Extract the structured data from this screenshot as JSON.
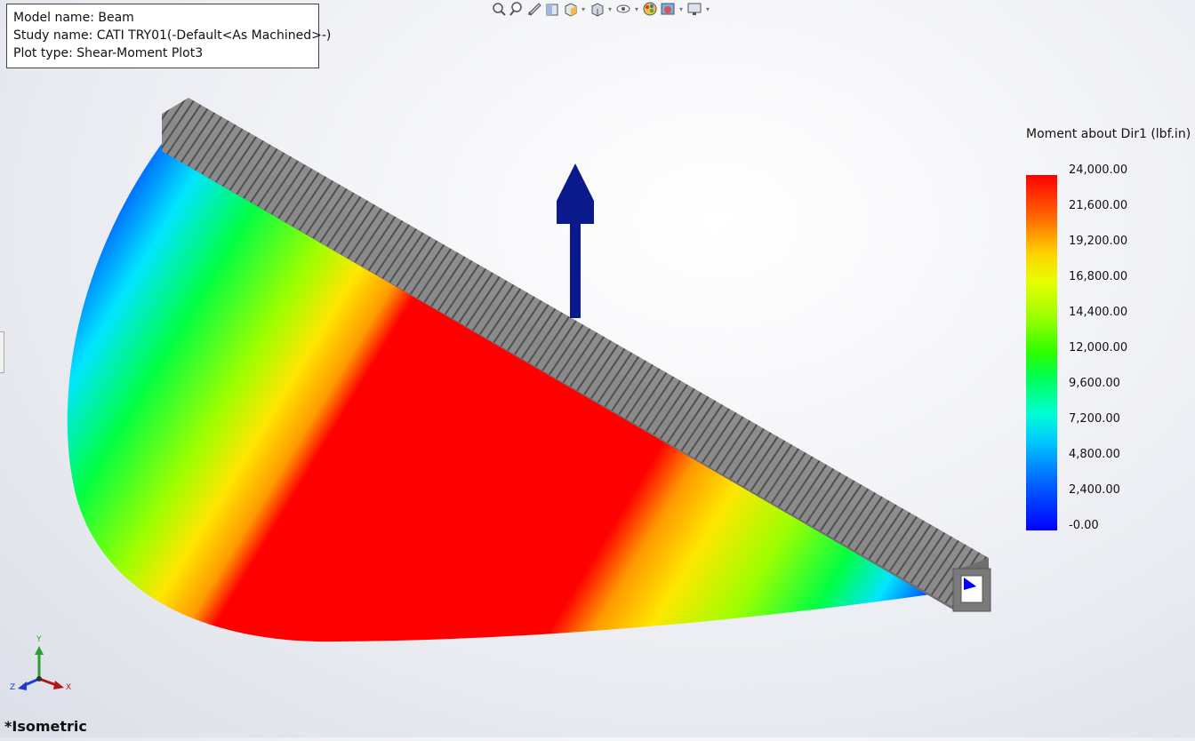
{
  "info": {
    "model_prefix": "Model name:",
    "model_name": "Beam",
    "study_prefix": "Study name:",
    "study_name": "CATI TRY01(-Default<As Machined>-)",
    "plot_prefix": "Plot type:",
    "plot_type": "Shear-Moment Plot3"
  },
  "toolbar": {
    "icons": [
      "zoom-to-fit-icon",
      "zoom-to-area-icon",
      "previous-view-icon",
      "section-view-icon",
      "view-orientation-icon",
      "display-style-icon",
      "hide-show-items-icon",
      "edit-appearance-icon",
      "apply-scene-icon",
      "view-settings-icon"
    ]
  },
  "legend": {
    "title": "Moment about Dir1 (lbf.in)",
    "ticks": [
      "24,000.00",
      "21,600.00",
      "19,200.00",
      "16,800.00",
      "14,400.00",
      "12,000.00",
      "9,600.00",
      "7,200.00",
      "4,800.00",
      "2,400.00",
      "-0.00"
    ],
    "colors": {
      "max": "#ff0000",
      "mid": "#00ff00",
      "min": "#0000ff"
    }
  },
  "triad": {
    "x": "X",
    "y": "Y",
    "z": "Z"
  },
  "view_label": "*Isometric",
  "colors": {
    "beam": "#8a8a8a",
    "load_arrow": "#0a1a8c"
  }
}
